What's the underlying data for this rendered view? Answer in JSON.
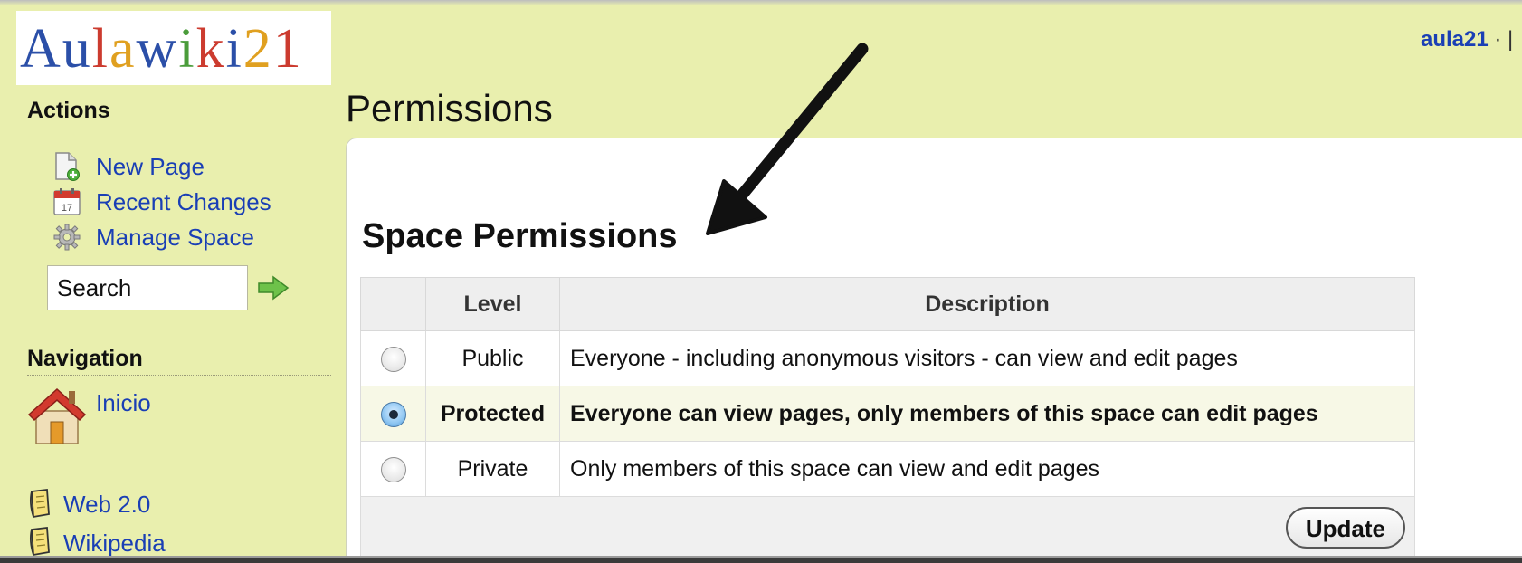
{
  "logo": {
    "letters": [
      {
        "ch": "A",
        "color": "#2b4fa8"
      },
      {
        "ch": "u",
        "color": "#2b4fa8"
      },
      {
        "ch": "l",
        "color": "#cc3b2f"
      },
      {
        "ch": "a",
        "color": "#e0a020"
      },
      {
        "ch": "w",
        "color": "#2b4fa8"
      },
      {
        "ch": "i",
        "color": "#4a9c3a"
      },
      {
        "ch": "k",
        "color": "#cc3b2f"
      },
      {
        "ch": "i",
        "color": "#2b4fa8"
      },
      {
        "ch": "2",
        "color": "#e0a020"
      },
      {
        "ch": "1",
        "color": "#cc3b2f"
      }
    ]
  },
  "header": {
    "user": "aula21",
    "separator": " · |"
  },
  "actions": {
    "heading": "Actions",
    "items": [
      {
        "label": "New Page",
        "icon": "new-page-icon"
      },
      {
        "label": "Recent Changes",
        "icon": "calendar-icon"
      },
      {
        "label": "Manage Space",
        "icon": "gear-icon"
      }
    ],
    "search": {
      "value": "Search"
    }
  },
  "navigation": {
    "heading": "Navigation",
    "items": [
      {
        "label": "Inicio",
        "icon": "home-icon"
      },
      {
        "label": "Web 2.0",
        "icon": "note-icon"
      },
      {
        "label": "Wikipedia",
        "icon": "note-icon"
      }
    ]
  },
  "page": {
    "title": "Permissions"
  },
  "permissions": {
    "section_title": "Space Permissions",
    "columns": [
      "",
      "Level",
      "Description"
    ],
    "rows": [
      {
        "level": "Public",
        "description": "Everyone - including anonymous visitors - can view and edit pages",
        "selected": false
      },
      {
        "level": "Protected",
        "description": "Everyone can view pages, only members of this space can edit pages",
        "selected": true
      },
      {
        "level": "Private",
        "description": "Only members of this space can view and edit pages",
        "selected": false
      }
    ],
    "update_label": "Update"
  },
  "colors": {
    "link": "#1a3fb5",
    "background": "#e9efae",
    "selected_row": "#f7f8e6"
  }
}
